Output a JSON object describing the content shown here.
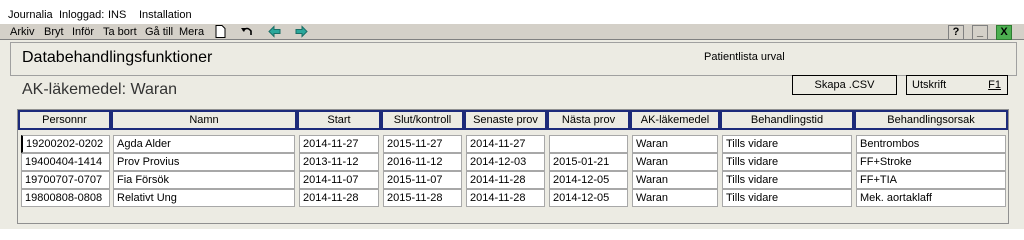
{
  "titlebar": {
    "app": "Journalia",
    "logged_label": "Inloggad:",
    "user": "INS",
    "site": "Installation"
  },
  "menu": [
    "Arkiv",
    "Bryt",
    "Inför",
    "Ta bort",
    "Gå till",
    "Mera"
  ],
  "window_buttons": {
    "help": "?",
    "minimize": "_",
    "close": "X"
  },
  "header": {
    "title": "Databehandlingsfunktioner",
    "view": "Patientlista urval"
  },
  "section_title": "AK-läkemedel: Waran",
  "buttons": {
    "csv": "Skapa .CSV",
    "print": "Utskrift",
    "print_key": "F1"
  },
  "table": {
    "columns": [
      "Personnr",
      "Namn",
      "Start",
      "Slut/kontroll",
      "Senaste prov",
      "Nästa prov",
      "AK-läkemedel",
      "Behandlingstid",
      "Behandlingsorsak"
    ],
    "rows": [
      [
        "19200202-0202",
        "Agda Alder",
        "2014-11-27",
        "2015-11-27",
        "2014-11-27",
        "",
        "Waran",
        "Tills vidare",
        "Bentrombos"
      ],
      [
        "19400404-1414",
        "Prov Provius",
        "2013-11-12",
        "2016-11-12",
        "2014-12-03",
        "2015-01-21",
        "Waran",
        "Tills vidare",
        "FF+Stroke"
      ],
      [
        "19700707-0707",
        "Fia Försök",
        "2014-11-07",
        "2015-11-07",
        "2014-11-28",
        "2014-12-05",
        "Waran",
        "Tills vidare",
        "FF+TIA"
      ],
      [
        "19800808-0808",
        "Relativt Ung",
        "2014-11-28",
        "2015-11-28",
        "2014-11-28",
        "2014-12-05",
        "Waran",
        "Tills vidare",
        "Mek. aortaklaff"
      ]
    ]
  }
}
